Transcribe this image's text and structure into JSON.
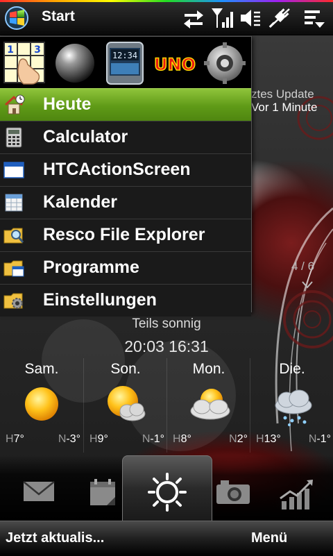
{
  "title_bar": {
    "title": "Start",
    "status_icons": [
      "sync-arrows-icon",
      "signal-strength-icon",
      "volume-muted-icon",
      "power-plug-icon",
      "start-menu-list-icon"
    ]
  },
  "start_menu": {
    "recent_apps": [
      "calculator-keypad-app-icon",
      "sphere-app-icon",
      "htc-screen-app-icon",
      "uno-app-icon",
      "settings-disc-app-icon"
    ],
    "recent_app_text": {
      "uno": "UNO",
      "clock": "12:34"
    },
    "items": [
      {
        "label": "Heute",
        "icon": "home-icon",
        "selected": true
      },
      {
        "label": "Calculator",
        "icon": "calculator-icon",
        "selected": false
      },
      {
        "label": "HTCActionScreen",
        "icon": "window-icon",
        "selected": false
      },
      {
        "label": "Kalender",
        "icon": "calendar-icon",
        "selected": false
      },
      {
        "label": "Resco File Explorer",
        "icon": "folder-search-icon",
        "selected": false
      },
      {
        "label": "Programme",
        "icon": "folder-programs-icon",
        "selected": false
      },
      {
        "label": "Einstellungen",
        "icon": "folder-settings-icon",
        "selected": false
      }
    ]
  },
  "weather": {
    "update_label": "ztes Update",
    "update_time": "Vor 1 Minute",
    "page_indicator": "4 / 6",
    "condition": "Teils sonnig",
    "datetime": "20:03 16:31",
    "forecast": [
      {
        "day": "Sam.",
        "icon": "sunny-icon",
        "high_prefix": "H",
        "high": "7°",
        "low_prefix": "N",
        "low": "-3°"
      },
      {
        "day": "Son.",
        "icon": "partly-sunny-icon",
        "high_prefix": "H",
        "high": "9°",
        "low_prefix": "N",
        "low": "-1°"
      },
      {
        "day": "Mon.",
        "icon": "cloudy-sun-icon",
        "high_prefix": "H",
        "high": "8°",
        "low_prefix": "N",
        "low": "2°"
      },
      {
        "day": "Die.",
        "icon": "snow-cloud-icon",
        "high_prefix": "H",
        "high": "13°",
        "low_prefix": "N",
        "low": "-1°"
      }
    ]
  },
  "tabs": [
    {
      "name": "tab-messages",
      "icon": "envelope-icon"
    },
    {
      "name": "tab-calendar",
      "icon": "calendar-tab-icon"
    },
    {
      "name": "tab-weather",
      "icon": "sun-icon",
      "active": true
    },
    {
      "name": "tab-camera",
      "icon": "camera-icon"
    },
    {
      "name": "tab-stocks",
      "icon": "chart-icon"
    }
  ],
  "softkeys": {
    "left": "Jetzt aktualis...",
    "right": "Menü"
  },
  "colors": {
    "selection_green": "#6aa61f",
    "menu_bg": "#1a1a1a",
    "bar_black": "#000000"
  }
}
